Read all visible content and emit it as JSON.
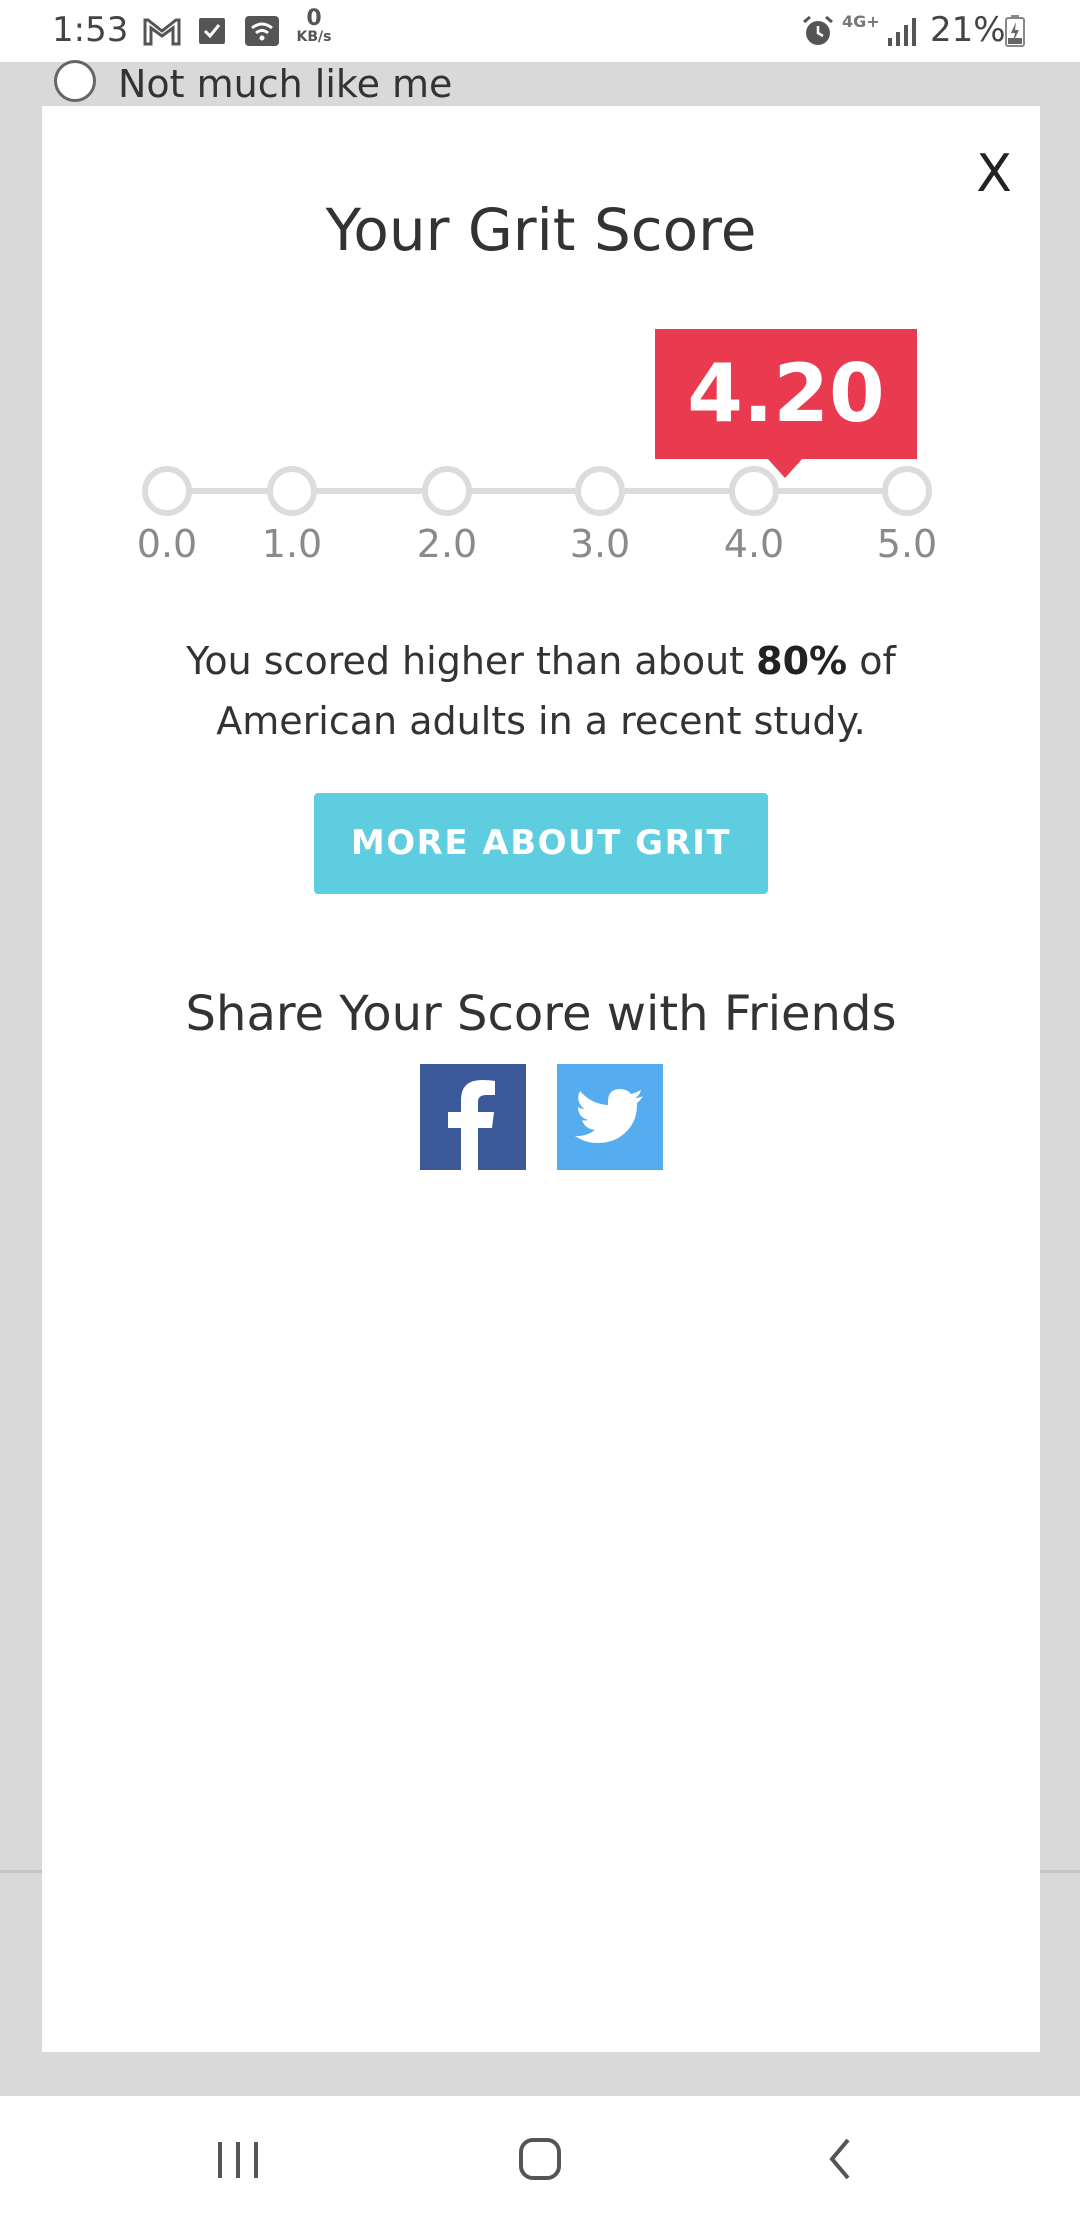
{
  "status_bar": {
    "time": "1:53",
    "speed_value": "0",
    "speed_unit": "KB/s",
    "network": "4G+",
    "battery": "21%",
    "icons": [
      "gmail-icon",
      "check-icon",
      "wifi-icon",
      "alarm-icon",
      "signal-icon",
      "battery-charging-icon"
    ]
  },
  "background": {
    "option_label": "Not much like me"
  },
  "modal": {
    "close_label": "X",
    "title": "Your Grit Score",
    "score": "4.20",
    "score_value": 4.2,
    "scale_ticks": [
      "0.0",
      "1.0",
      "2.0",
      "3.0",
      "4.0",
      "5.0"
    ],
    "result_prefix": "You scored higher than about ",
    "result_percent": "80%",
    "result_suffix": " of",
    "result_line2": "American adults in a recent study.",
    "more_button": "MORE ABOUT GRIT",
    "share_title": "Share Your Score with Friends",
    "share_icons": [
      "facebook-icon",
      "twitter-icon"
    ]
  },
  "navbar": {
    "buttons": [
      "recent-apps-icon",
      "home-icon",
      "back-icon"
    ]
  },
  "colors": {
    "badge": "#e93a4f",
    "button": "#5ecde0",
    "facebook": "#3b5998",
    "twitter": "#55acee"
  }
}
